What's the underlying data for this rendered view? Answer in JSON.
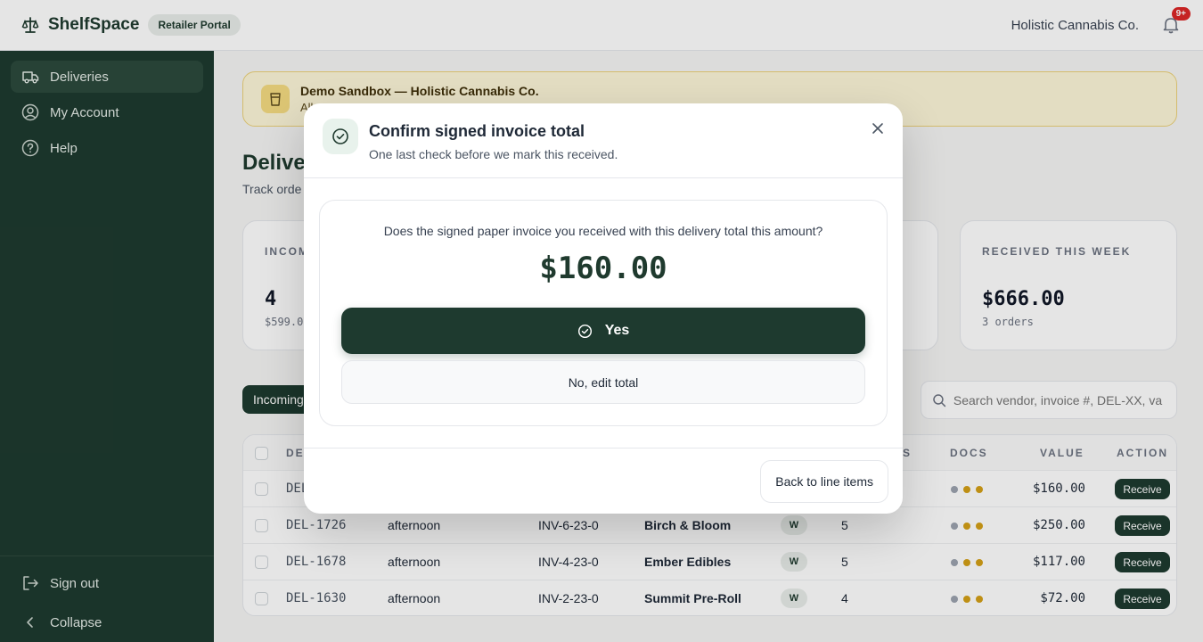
{
  "header": {
    "brand": "ShelfSpace",
    "portal_badge": "Retailer Portal",
    "company": "Holistic Cannabis Co.",
    "notifications_badge": "9+"
  },
  "sidebar": {
    "items": [
      {
        "label": "Deliveries",
        "icon": "truck-icon",
        "active": true
      },
      {
        "label": "My Account",
        "icon": "user-circle-icon",
        "active": false
      },
      {
        "label": "Help",
        "icon": "help-circle-icon",
        "active": false
      }
    ],
    "sign_out": "Sign out",
    "collapse": "Collapse"
  },
  "banner": {
    "title": "Demo Sandbox — Holistic Cannabis Co.",
    "subtitle": "All"
  },
  "page": {
    "title": "Deliver",
    "subtitle": "Track orde"
  },
  "stats": [
    {
      "label": "INCOM",
      "value": "4",
      "sub": "$599.0"
    },
    {
      "label": "RECEIVED THIS WEEK",
      "value": "$666.00",
      "sub": "3 orders"
    }
  ],
  "tabs": {
    "incoming": "Incoming"
  },
  "search": {
    "placeholder": "Search vendor, invoice #, DEL-XX, va"
  },
  "table": {
    "headers": {
      "delivery": "DE",
      "items": "S",
      "docs": "DOCS",
      "value": "VALUE",
      "action": "ACTION"
    },
    "rows": [
      {
        "id": "DEL",
        "window": "",
        "invoice": "",
        "vendor": "",
        "badge": "",
        "items": "",
        "value": "$160.00",
        "action": "Receive"
      },
      {
        "id": "DEL-1726",
        "window": "afternoon",
        "invoice": "INV-6-23-0",
        "vendor": "Birch & Bloom",
        "badge": "W",
        "items": "5",
        "value": "$250.00",
        "action": "Receive"
      },
      {
        "id": "DEL-1678",
        "window": "afternoon",
        "invoice": "INV-4-23-0",
        "vendor": "Ember Edibles",
        "badge": "W",
        "items": "5",
        "value": "$117.00",
        "action": "Receive"
      },
      {
        "id": "DEL-1630",
        "window": "afternoon",
        "invoice": "INV-2-23-0",
        "vendor": "Summit Pre-Roll",
        "badge": "W",
        "items": "4",
        "value": "$72.00",
        "action": "Receive"
      }
    ],
    "doc_dot_colors": [
      "#9ca3af",
      "#d4a017",
      "#d4a017"
    ]
  },
  "modal": {
    "title": "Confirm signed invoice total",
    "subtitle": "One last check before we mark this received.",
    "question": "Does the signed paper invoice you received with this delivery total this amount?",
    "amount": "$160.00",
    "yes_label": "Yes",
    "no_label": "No, edit total",
    "back_label": "Back to line items"
  },
  "colors": {
    "brand_green": "#1e3a2f",
    "banner_bg": "#fdf6d8",
    "notification_red": "#dc2626"
  }
}
